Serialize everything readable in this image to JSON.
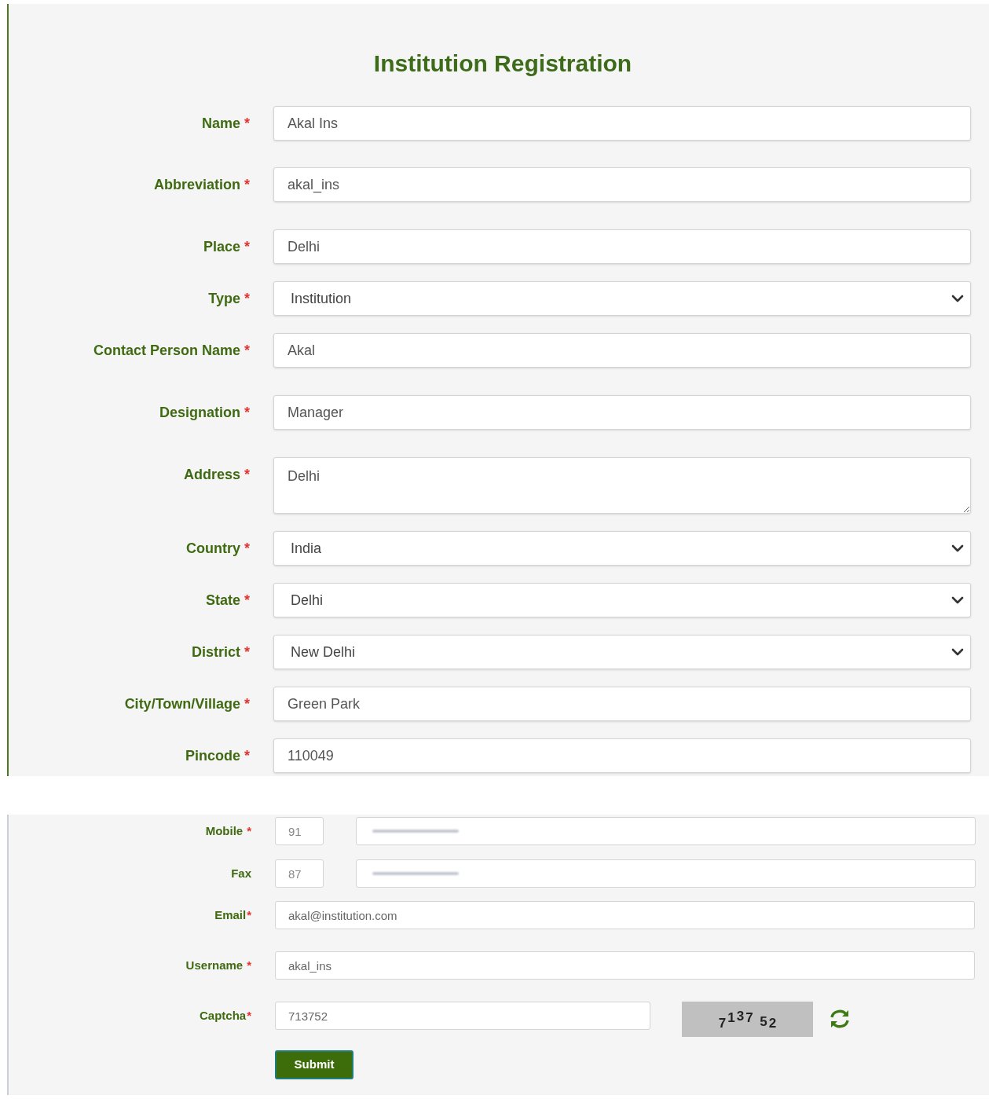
{
  "title": "Institution Registration",
  "fields": [
    {
      "label": "Name",
      "required_mark": "*",
      "kind": "text",
      "value": "Akal Ins"
    },
    {
      "label": "Abbreviation",
      "required_mark": "*",
      "kind": "text",
      "value": "akal_ins"
    },
    {
      "label": "Place",
      "required_mark": "*",
      "kind": "text",
      "value": "Delhi"
    },
    {
      "label": "Type",
      "required_mark": "*",
      "kind": "select",
      "value": "Institution"
    },
    {
      "label": "Contact Person Name",
      "required_mark": "*",
      "kind": "text",
      "value": "Akal"
    },
    {
      "label": "Designation",
      "required_mark": "*",
      "kind": "text",
      "value": "Manager"
    },
    {
      "label": "Address",
      "required_mark": "*",
      "kind": "textarea",
      "value": "Delhi"
    },
    {
      "label": "Country",
      "required_mark": "*",
      "kind": "select",
      "value": "India"
    },
    {
      "label": "State",
      "required_mark": "*",
      "kind": "select",
      "value": "Delhi"
    },
    {
      "label": "District",
      "required_mark": "*",
      "kind": "select",
      "value": "New Delhi"
    },
    {
      "label": "City/Town/Village",
      "required_mark": "*",
      "kind": "text",
      "value": "Green Park"
    },
    {
      "label": "Pincode",
      "required_mark": "*",
      "kind": "text",
      "value": "110049"
    }
  ],
  "contact_fields": [
    {
      "label": "Mobile",
      "required_mark": "*",
      "kind": "phone",
      "prefix": "91",
      "blurred": true
    },
    {
      "label": "Fax",
      "kind": "phone",
      "prefix": "87",
      "blurred": true
    },
    {
      "label": "Email",
      "required_mark": "*",
      "kind": "text",
      "value": "akal@institution.com"
    },
    {
      "label": "Username",
      "required_mark": "*",
      "kind": "text",
      "value": "akal_ins"
    },
    {
      "label": "Captcha",
      "required_mark": "*",
      "kind": "captcha",
      "value": "713752",
      "image_text": "7137 52"
    }
  ],
  "submit": "Submit"
}
